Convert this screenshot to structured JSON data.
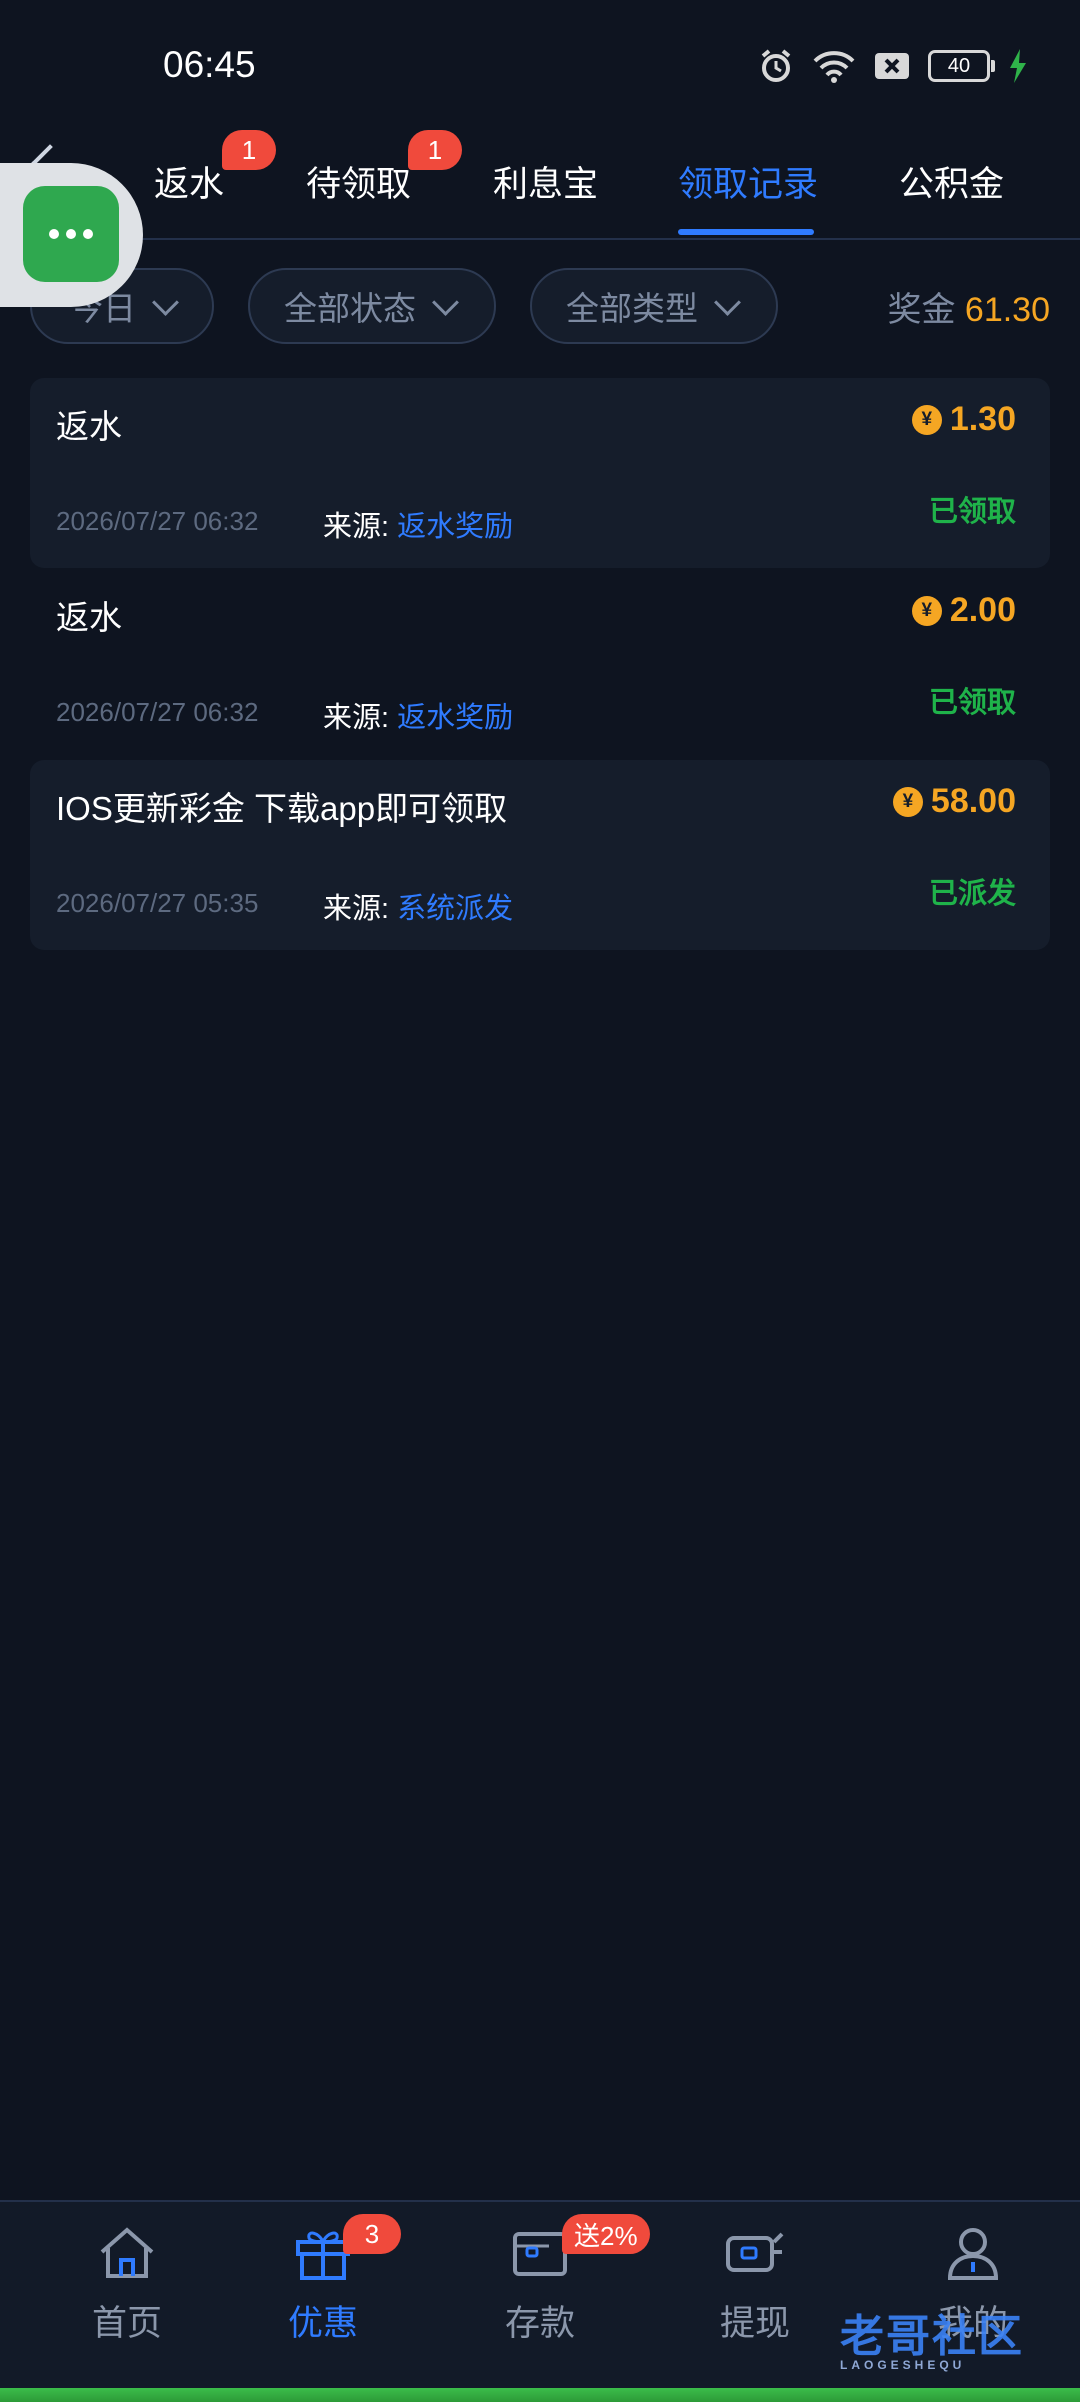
{
  "status_bar": {
    "time": "06:45",
    "battery": "40"
  },
  "tabs": [
    {
      "label": "返水",
      "badge": "1"
    },
    {
      "label": "待领取",
      "badge": "1"
    },
    {
      "label": "利息宝"
    },
    {
      "label": "领取记录",
      "active": true
    },
    {
      "label": "公积金"
    }
  ],
  "filters": {
    "date": "今日",
    "status": "全部状态",
    "type": "全部类型"
  },
  "bonus": {
    "label": "奖金",
    "amount": "61.30"
  },
  "records": [
    {
      "title": "返水",
      "amount": "1.30",
      "status": "已领取",
      "time": "2026/07/27 06:32",
      "source_label": "来源:",
      "source": "返水奖励"
    },
    {
      "title": "返水",
      "amount": "2.00",
      "status": "已领取",
      "time": "2026/07/27 06:32",
      "source_label": "来源:",
      "source": "返水奖励"
    },
    {
      "title": "IOS更新彩金  下载app即可领取",
      "amount": "58.00",
      "status": "已派发",
      "time": "2026/07/27 05:35",
      "source_label": "来源:",
      "source": "系统派发"
    }
  ],
  "coin_symbol": "¥",
  "bottom_nav": [
    {
      "label": "首页",
      "icon": "home-icon"
    },
    {
      "label": "优惠",
      "icon": "gift-icon",
      "badge": "3",
      "active": true
    },
    {
      "label": "存款",
      "icon": "wallet-icon",
      "badge": "送2%"
    },
    {
      "label": "提现",
      "icon": "withdraw-icon"
    },
    {
      "label": "我的",
      "icon": "user-icon"
    }
  ],
  "watermark": {
    "text": "老哥社区",
    "sub": "LAOGESHEQU"
  },
  "colors": {
    "accent": "#2f7bff",
    "gold": "#f5a623",
    "success": "#1fb34a",
    "badge": "#f04a3c",
    "background": "#0e1420"
  }
}
